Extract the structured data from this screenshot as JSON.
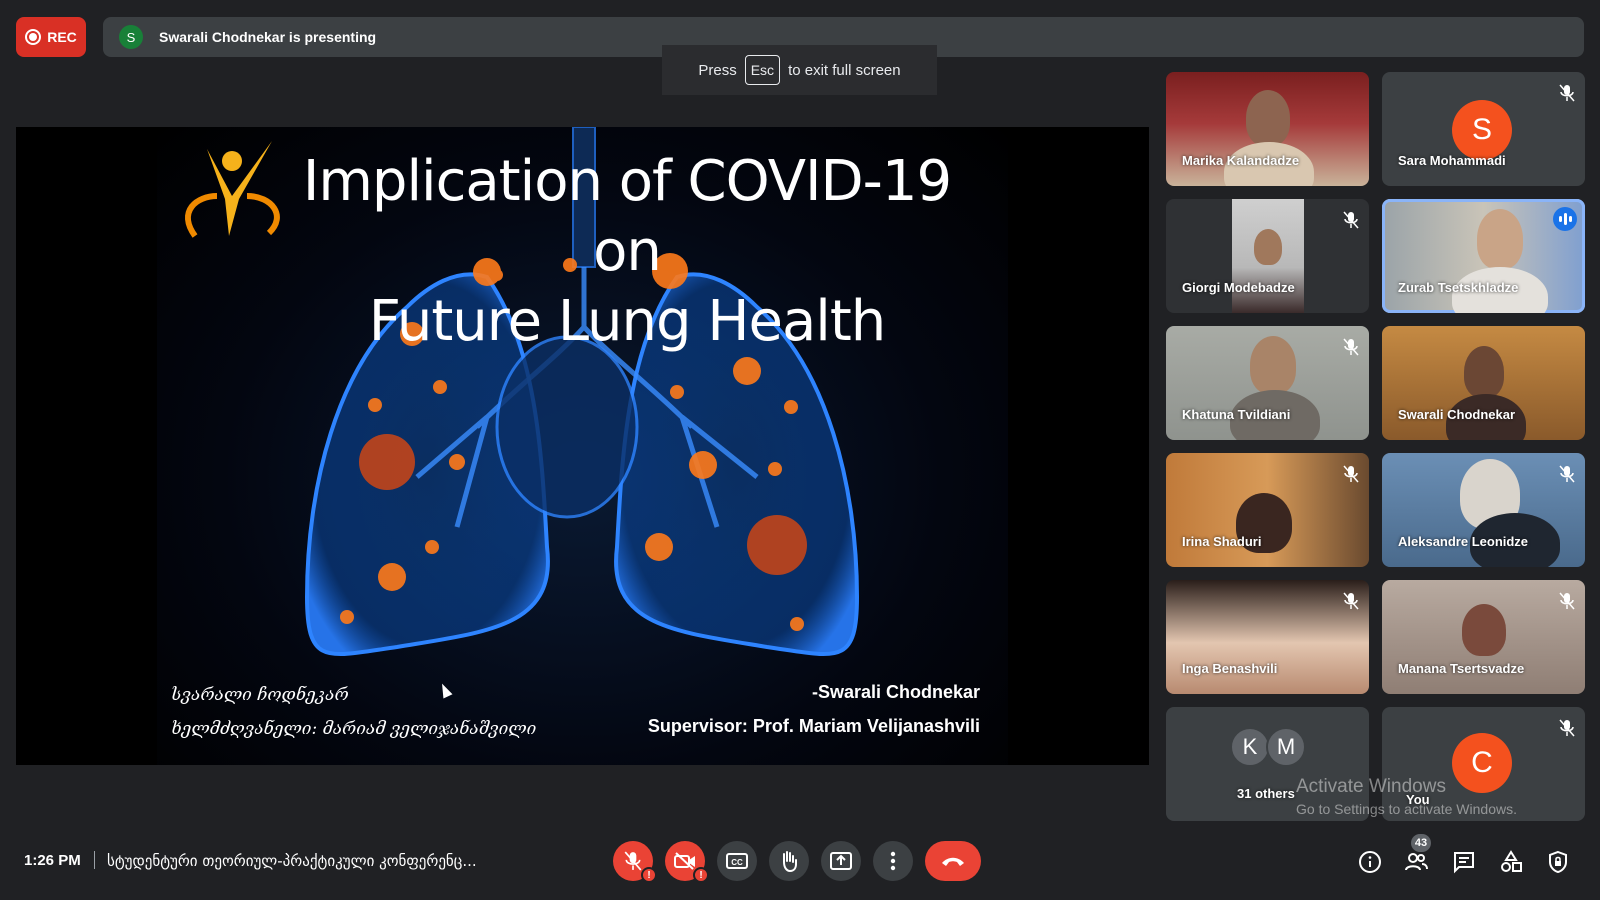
{
  "recording": {
    "label": "REC"
  },
  "presenter": {
    "initial": "S",
    "text": "Swarali Chodnekar is presenting"
  },
  "fullscreen_hint": {
    "press": "Press",
    "key": "Esc",
    "rest": "to exit full screen"
  },
  "slide": {
    "title_line1": "Implication of COVID-19 on",
    "title_line2": "Future Lung Health",
    "georgian_line1": "სვარალი ჩოდნეკარ",
    "georgian_line2": "ხელმძღვანელი: მარიამ ველიჯანაშვილი",
    "author": "-Swarali Chodnekar",
    "supervisor": "Supervisor: Prof. Mariam Velijanashvili"
  },
  "participants": [
    {
      "name": "Marika Kalandadze",
      "muted": false
    },
    {
      "name": "Sara Mohammadi",
      "initial": "S",
      "avatar_color": "#f4511e",
      "muted": true
    },
    {
      "name": "Giorgi Modebadze",
      "muted": true
    },
    {
      "name": "Zurab Tsetskhladze",
      "speaking": true
    },
    {
      "name": "Khatuna Tvildiani",
      "muted": true
    },
    {
      "name": "Swarali Chodnekar",
      "muted": false
    },
    {
      "name": "Irina Shaduri",
      "muted": true
    },
    {
      "name": "Aleksandre Leonidze",
      "muted": true
    },
    {
      "name": "Inga Benashvili",
      "muted": true
    },
    {
      "name": "Manana Tsertsvadze",
      "muted": true
    }
  ],
  "others": {
    "label": "31 others",
    "avatars": [
      {
        "initial": "K",
        "color": "#5f6368"
      },
      {
        "initial": "M",
        "color": "#5f6368"
      }
    ]
  },
  "self": {
    "label": "You",
    "initial": "C",
    "avatar_color": "#f4511e"
  },
  "watermark": {
    "line1": "Activate Windows",
    "line2": "Go to Settings to activate Windows."
  },
  "bottom_bar": {
    "time": "1:26 PM",
    "meeting_title": "სტუდენტური თეორიულ-პრაქტიკული კონფერენც...",
    "participant_count": "43"
  },
  "colors": {
    "background": "#202124",
    "danger": "#ea4335",
    "accent": "#8ab4f8",
    "panel": "#3c4043"
  }
}
